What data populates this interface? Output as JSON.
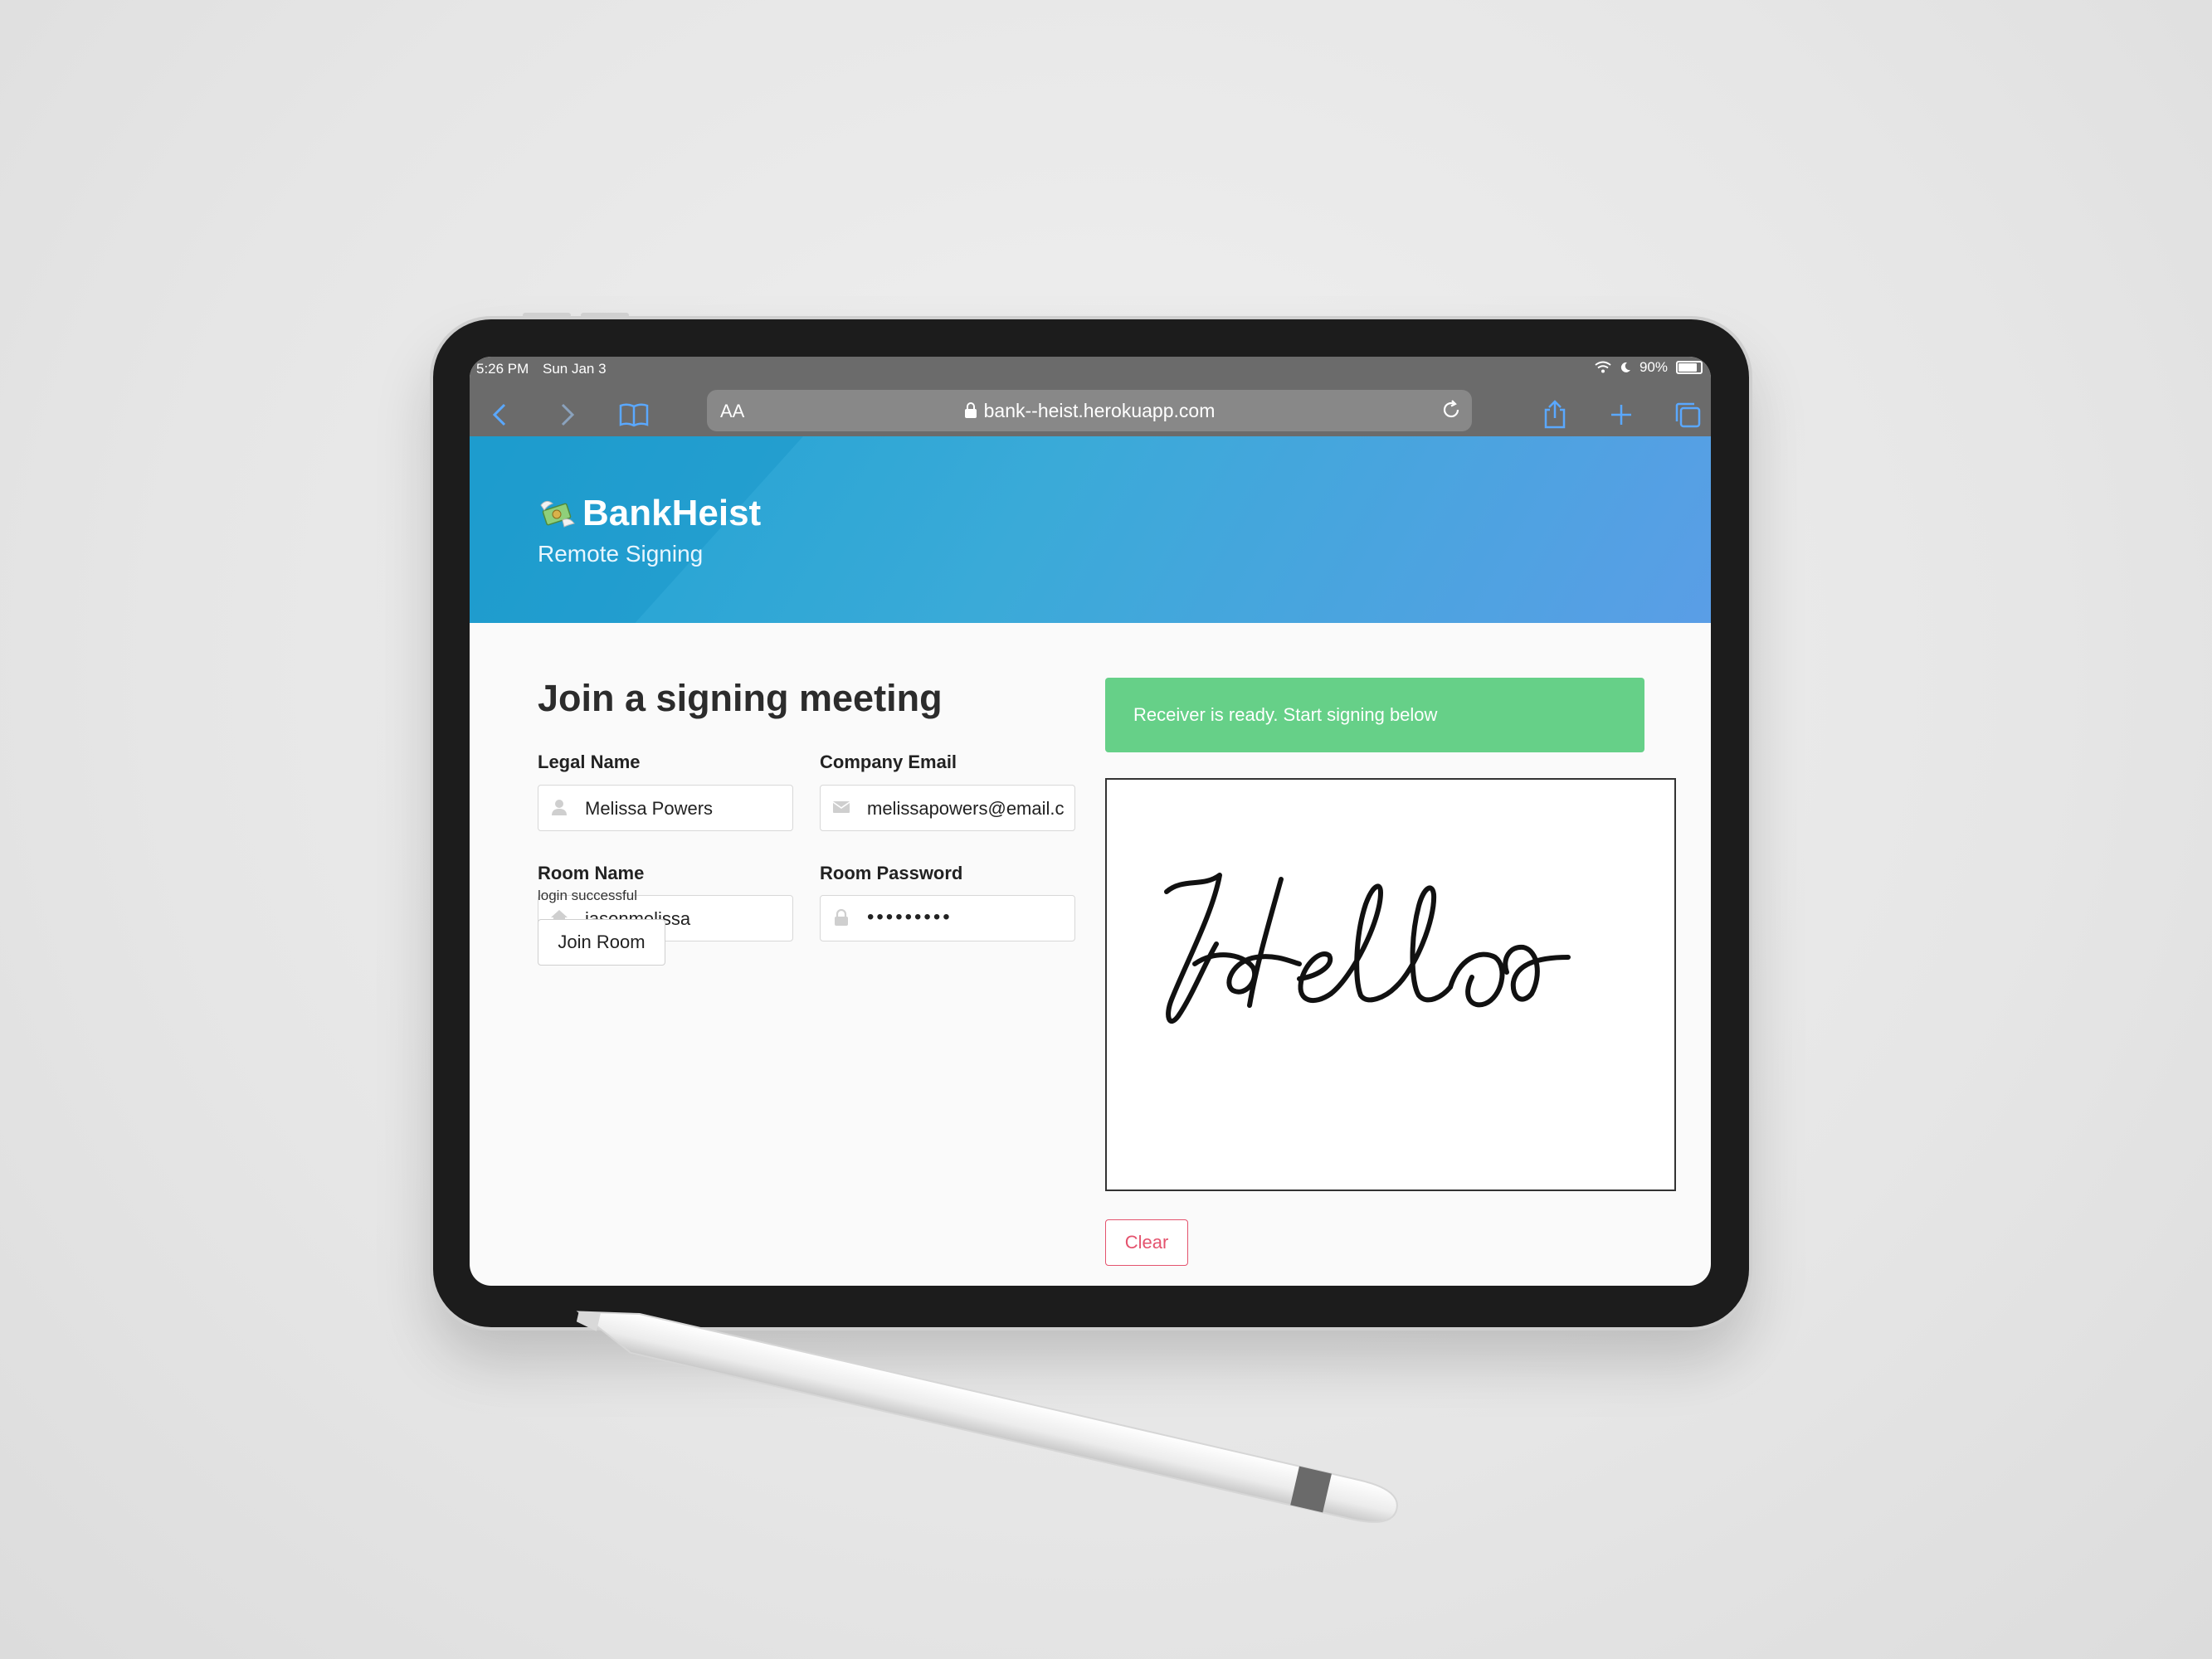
{
  "status_bar": {
    "time": "5:26 PM",
    "date": "Sun Jan 3",
    "battery": "90%"
  },
  "browser": {
    "text_size_button": "AA",
    "url": "bank--heist.herokuapp.com",
    "icons": [
      "back-icon",
      "forward-icon",
      "bookmarks-icon",
      "lock-icon",
      "reload-icon",
      "share-icon",
      "new-tab-icon",
      "tabs-icon"
    ],
    "accent_color": "#5aa8ff"
  },
  "header": {
    "brand": "BankHeist",
    "tagline": "Remote Signing",
    "logo_icon": "money-with-wings-icon",
    "gradient_colors": [
      "#1fa2d2",
      "#5a9ee6"
    ]
  },
  "form": {
    "title": "Join a signing meeting",
    "legal_name_label": "Legal Name",
    "legal_name_value": "Melissa Powers",
    "company_email_label": "Company Email",
    "company_email_value": "melissapowers@email.c",
    "room_name_label": "Room Name",
    "room_name_value": "jasonmelissa",
    "room_password_label": "Room Password",
    "room_password_value": "•••••••••",
    "status_note": "login successful",
    "join_button": "Join Room"
  },
  "signing": {
    "alert_text": "Receiver is ready. Start signing below",
    "alert_color": "#66d088",
    "clear_button": "Clear",
    "clear_color": "#e4536e"
  }
}
